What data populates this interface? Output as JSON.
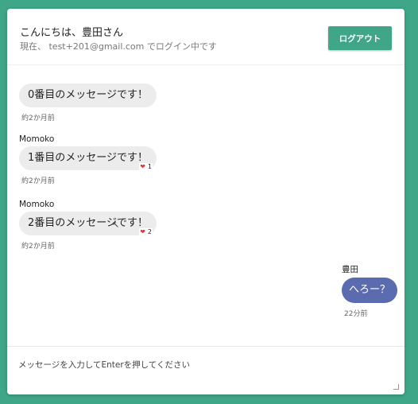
{
  "header": {
    "greeting": "こんにちは、豊田さん",
    "login_info": "現在、 test+201@gmail.com でログイン中です",
    "logout_label": "ログアウト"
  },
  "messages": [
    {
      "sender": "",
      "text": "0番目のメッセージです！",
      "time": "約2か月前",
      "likes": ""
    },
    {
      "sender": "Momoko",
      "text": "1番目のメッセージです！",
      "time": "約2か月前",
      "likes": "1"
    },
    {
      "sender": "Momoko",
      "text": "2番目のメッセージです！",
      "time": "約2か月前",
      "likes": "2"
    },
    {
      "sender": "豊田",
      "text": "へろー？",
      "time": "22分前",
      "likes": "",
      "mine": true
    }
  ],
  "composer": {
    "placeholder": "メッセージを入力してEnterを押してください"
  },
  "colors": {
    "background": "#3fa788",
    "accent": "#3fa788",
    "my_bubble": "#5b6bb0",
    "other_bubble": "#ececec",
    "heart": "#e53935"
  },
  "icons": {
    "like": "heart-icon",
    "cursor": "mouse-pointer-icon",
    "resize": "resize-grip-icon"
  }
}
